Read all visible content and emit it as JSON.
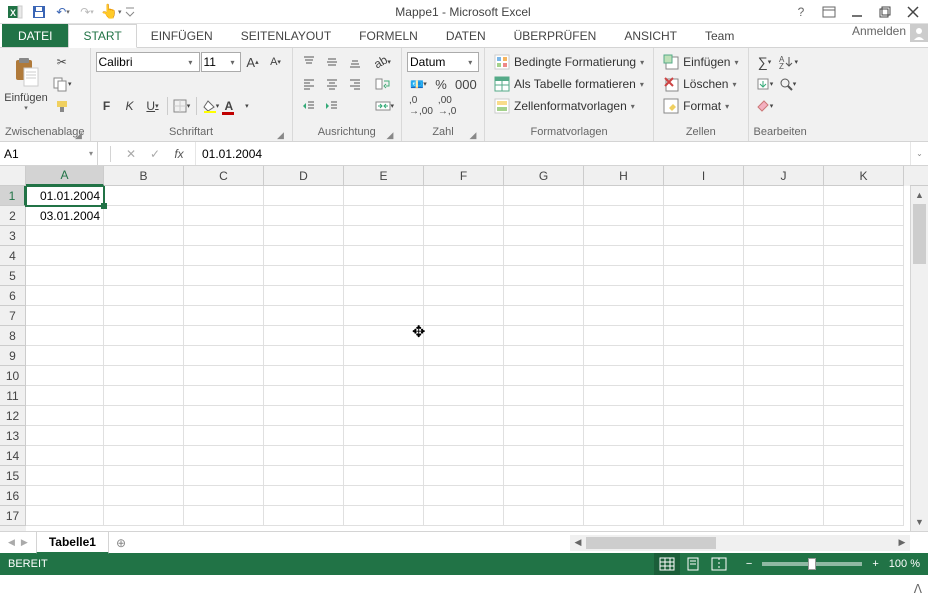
{
  "title": "Mappe1 - Microsoft Excel",
  "user_label": "Anmelden",
  "tabs": {
    "file": "DATEI",
    "start": "START",
    "einfuegen": "EINFÜGEN",
    "seitenlayout": "SEITENLAYOUT",
    "formeln": "FORMELN",
    "daten": "DATEN",
    "ueberpruefen": "ÜBERPRÜFEN",
    "ansicht": "ANSICHT",
    "team": "Team"
  },
  "ribbon": {
    "clipboard": {
      "label": "Zwischenablage",
      "paste": "Einfügen"
    },
    "font": {
      "label": "Schriftart",
      "name": "Calibri",
      "size": "11",
      "bold": "F",
      "italic": "K",
      "underline": "U"
    },
    "align": {
      "label": "Ausrichtung"
    },
    "number": {
      "label": "Zahl",
      "format": "Datum"
    },
    "styles": {
      "label": "Formatvorlagen",
      "cond": "Bedingte Formatierung",
      "table": "Als Tabelle formatieren",
      "cell": "Zellenformatvorlagen"
    },
    "cells": {
      "label": "Zellen",
      "insert": "Einfügen",
      "delete": "Löschen",
      "format": "Format"
    },
    "editing": {
      "label": "Bearbeiten"
    }
  },
  "fx": {
    "namebox": "A1",
    "formula": "01.01.2004"
  },
  "grid": {
    "cols": [
      "A",
      "B",
      "C",
      "D",
      "E",
      "F",
      "G",
      "H",
      "I",
      "J",
      "K"
    ],
    "rows": [
      1,
      2,
      3,
      4,
      5,
      6,
      7,
      8,
      9,
      10,
      11,
      12,
      13,
      14,
      15,
      16,
      17
    ],
    "values": {
      "A1": "01.01.2004",
      "A2": "03.01.2004"
    },
    "active": "A1"
  },
  "sheet": {
    "tab1": "Tabelle1"
  },
  "status": {
    "ready": "BEREIT",
    "zoom": "100 %"
  }
}
